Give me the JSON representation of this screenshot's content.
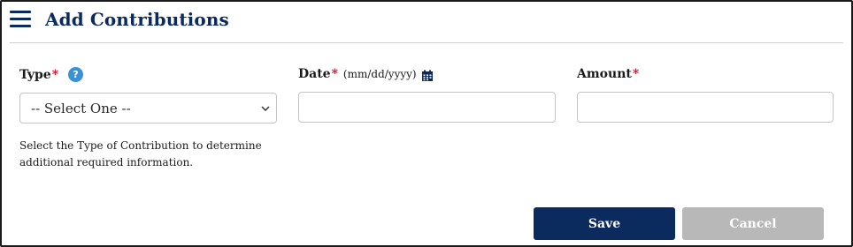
{
  "header": {
    "title": "Add Contributions"
  },
  "type_field": {
    "label": "Type",
    "required_mark": "*",
    "help_icon": "question-icon",
    "selected": "-- Select One --",
    "help_text": "Select the Type of Contribution to determine additional required information."
  },
  "date_field": {
    "label": "Date",
    "required_mark": "*",
    "hint": "(mm/dd/yyyy)",
    "icon": "calendar-icon",
    "value": ""
  },
  "amount_field": {
    "label": "Amount",
    "required_mark": "*",
    "value": ""
  },
  "actions": {
    "save_label": "Save",
    "cancel_label": "Cancel"
  },
  "colors": {
    "brand": "#0b2a5e",
    "required": "#c8102e",
    "help": "#3a91d6",
    "cancel_bg": "#b8b8b8"
  }
}
